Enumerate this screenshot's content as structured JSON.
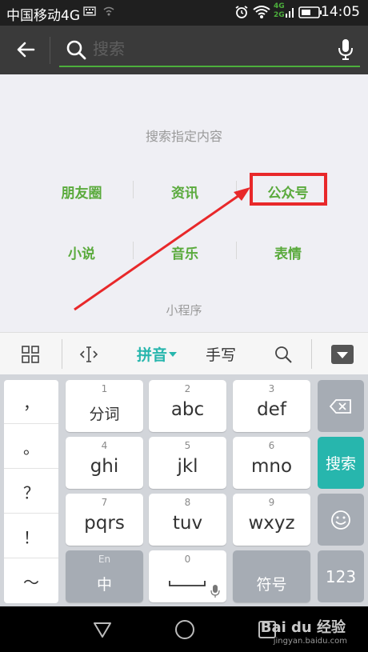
{
  "status_bar": {
    "carrier": "中国移动4G",
    "net_labels": [
      "4G",
      "2G"
    ],
    "time": "14:05"
  },
  "header": {
    "search_placeholder": "搜索"
  },
  "content": {
    "hint": "搜索指定内容",
    "categories": [
      "朋友圈",
      "资讯",
      "公众号",
      "小说",
      "音乐",
      "表情"
    ],
    "mini_program": "小程序",
    "highlight_color": "#e8282a"
  },
  "keyboard_toolbar": {
    "pinyin": "拼音",
    "handwriting": "手写"
  },
  "keyboard": {
    "punctuation": [
      "，",
      "。",
      "？",
      "！",
      "～"
    ],
    "keys": [
      {
        "num": "1",
        "label": "分词"
      },
      {
        "num": "2",
        "label": "abc"
      },
      {
        "num": "3",
        "label": "def"
      },
      {
        "num": "4",
        "label": "ghi"
      },
      {
        "num": "5",
        "label": "jkl"
      },
      {
        "num": "6",
        "label": "mno"
      },
      {
        "num": "7",
        "label": "pqrs"
      },
      {
        "num": "8",
        "label": "tuv"
      },
      {
        "num": "9",
        "label": "wxyz"
      }
    ],
    "lang_key": {
      "top": "En",
      "label": "中"
    },
    "space_num": "0",
    "symbol_key": "符号",
    "search_key": "搜索",
    "num_key": "123",
    "accent": "#27b6ad"
  },
  "watermark": {
    "brand": "Bai du 经验",
    "url": "jingyan.baidu.com"
  }
}
